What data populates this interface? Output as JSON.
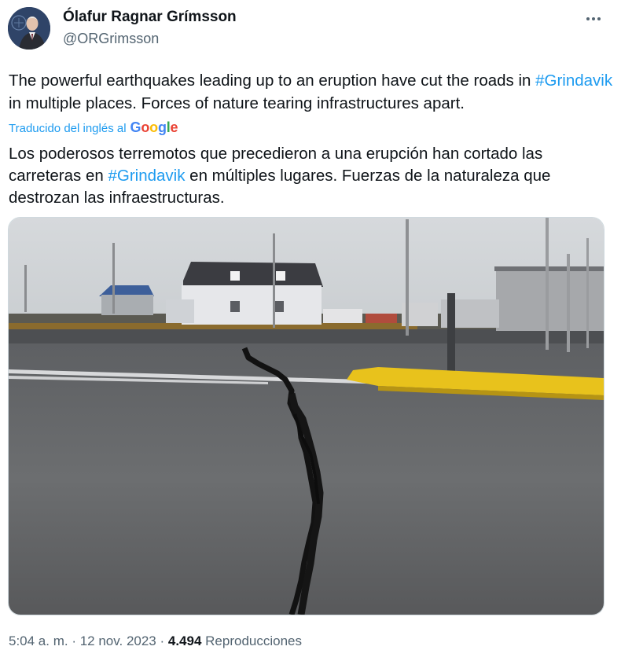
{
  "author": {
    "name": "Ólafur Ragnar Grímsson",
    "handle": "@ORGrimsson"
  },
  "tweet": {
    "text_part1": "The powerful earthquakes leading up to an eruption have cut the roads in ",
    "hashtag": "#Grindavik",
    "text_part2": " in multiple places. Forces of nature tearing infrastructures apart."
  },
  "translation": {
    "label": "Traducido del inglés al",
    "provider": "Google",
    "text_part1": "Los poderosos terremotos que precedieron a una erupción han cortado las carreteras en ",
    "hashtag": "#Grindavik",
    "text_part2": " en múltiples lugares. Fuerzas de la naturaleza que destrozan las infraestructuras."
  },
  "meta": {
    "time": "5:04 a. m.",
    "sep1": " · ",
    "date": "12 nov. 2023",
    "sep2": " · ",
    "views": "4.494",
    "views_label": " Reproducciones"
  },
  "icons": {
    "more": "more-options-icon"
  },
  "colors": {
    "link": "#1d9bf0",
    "text": "#0f1419",
    "secondary": "#536471",
    "curb_yellow": "#e8c21c"
  }
}
